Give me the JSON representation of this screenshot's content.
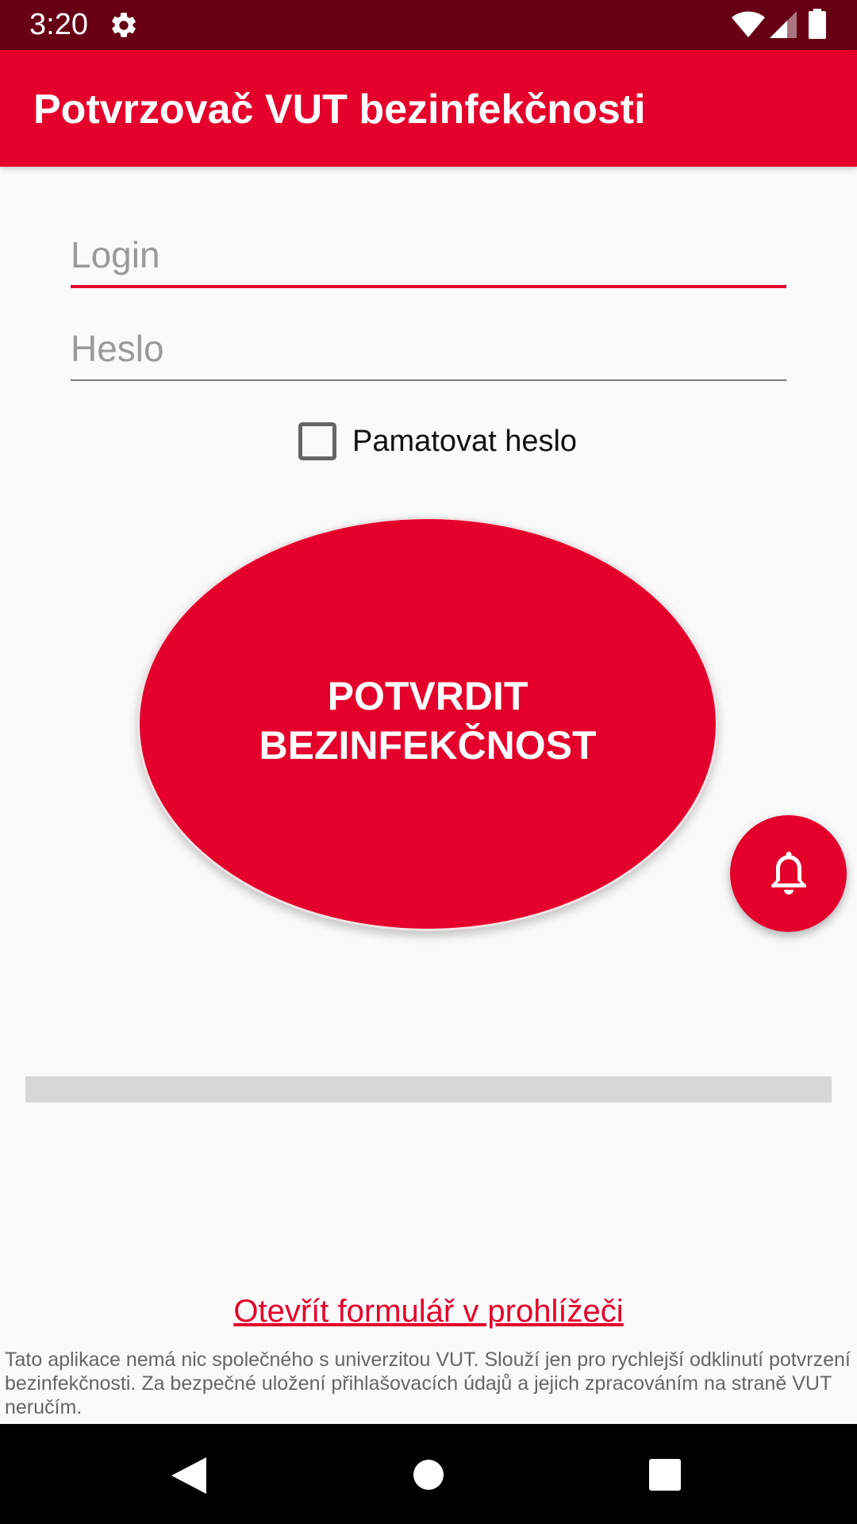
{
  "status_bar": {
    "time": "3:20",
    "icons": [
      "gear-icon",
      "wifi-icon",
      "cellular-signal-icon",
      "battery-icon"
    ]
  },
  "app_bar": {
    "title": "Potvrzovač VUT bezinfekčnosti"
  },
  "form": {
    "login": {
      "placeholder": "Login",
      "value": ""
    },
    "password": {
      "placeholder": "Heslo",
      "value": ""
    },
    "remember": {
      "label": "Pamatovat heslo",
      "checked": false
    }
  },
  "confirm_button": {
    "label": "POTVRDIT BEZINFEKČNOST"
  },
  "fab": {
    "icon": "bell-icon"
  },
  "progress": {
    "value": 0
  },
  "footer": {
    "link": "Otevřít formulář v prohlížeči",
    "disclaimer": "Tato aplikace nemá nic společného s univerzitou VUT. Slouží jen pro rychlejší odklinutí potvrzení bezinfekčnosti. Za bezpečné uložení přihlašovacích údajů a jejich zpracováním na straně VUT neručím."
  },
  "nav_bar": {
    "icons": [
      "back-icon",
      "home-icon",
      "recents-icon"
    ]
  },
  "colors": {
    "primary": "#e4002b",
    "primary_dark": "#670014",
    "background": "#fafafa"
  }
}
